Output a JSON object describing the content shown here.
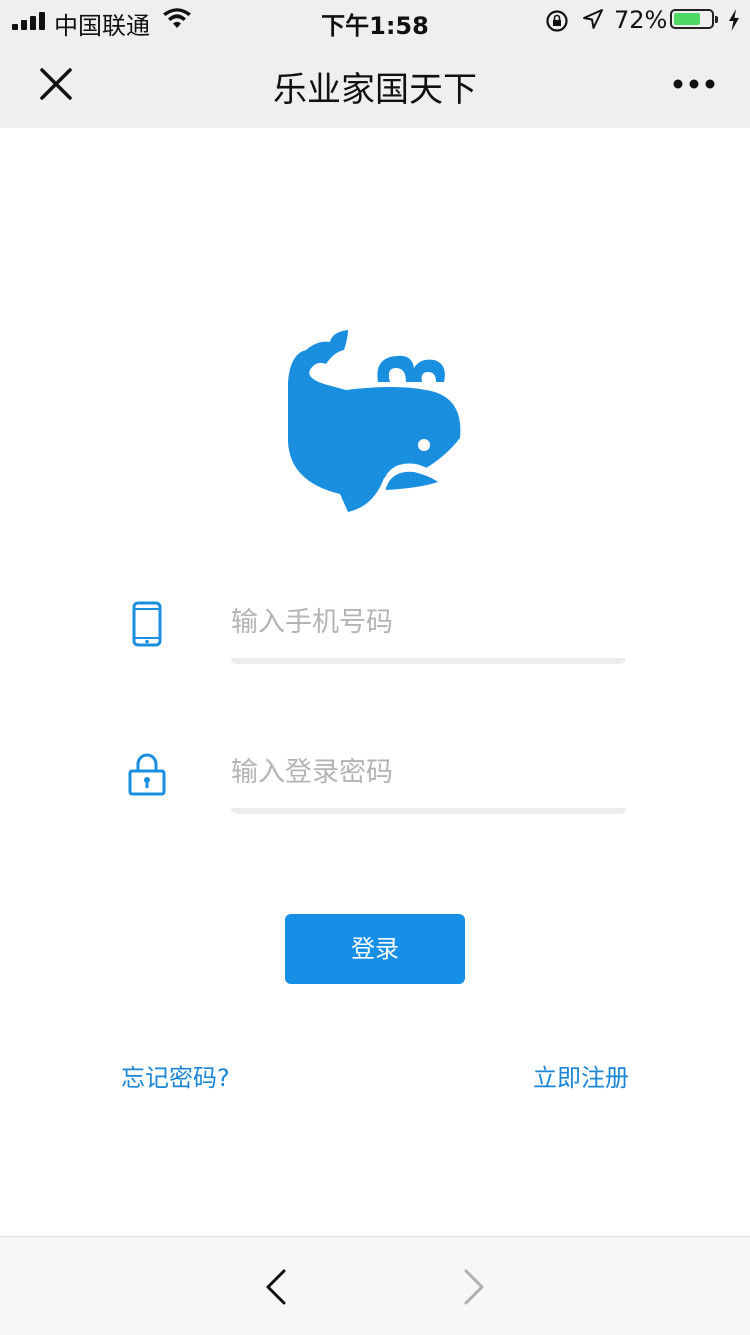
{
  "status_bar": {
    "carrier": "中国联通",
    "time": "下午1:58",
    "battery_percent_label": "72%",
    "battery_level": 0.72,
    "signal_icon": "signal-bars-icon",
    "wifi_icon": "wifi-icon",
    "orientation_lock_icon": "orientation-lock-icon",
    "location_icon": "location-arrow-icon",
    "charging_icon": "charging-bolt-icon"
  },
  "nav_bar": {
    "title": "乐业家国天下",
    "close_icon": "close-icon",
    "more_icon": "more-dots-icon"
  },
  "login_form": {
    "logo": "whale-logo",
    "phone_placeholder": "输入手机号码",
    "phone_value": "",
    "phone_icon": "phone-icon",
    "password_placeholder": "输入登录密码",
    "password_value": "",
    "password_icon": "lock-icon",
    "submit_label": "登录",
    "forgot_password_label": "忘记密码?",
    "register_label": "立即注册"
  },
  "bottom_toolbar": {
    "back_icon": "chevron-left-icon",
    "forward_icon": "chevron-right-icon",
    "forward_enabled": false
  },
  "colors": {
    "accent": "#1590e6",
    "link": "#1a86d4",
    "logo": "#1a8fe0",
    "bar_background": "#efefef",
    "battery_fill": "#4cd964",
    "placeholder": "#b4b4b4"
  }
}
